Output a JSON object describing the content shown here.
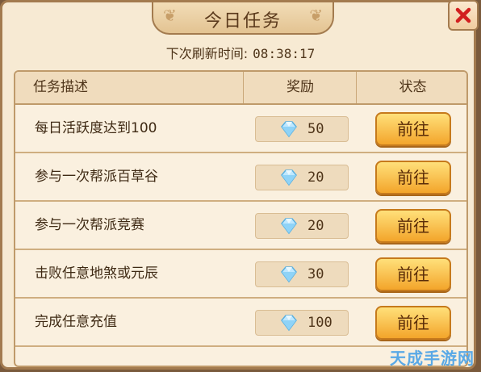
{
  "window": {
    "title": "今日任务"
  },
  "refresh": {
    "label": "下次刷新时间:",
    "time": "08:38:17"
  },
  "table": {
    "headers": {
      "desc": "任务描述",
      "reward": "奖励",
      "status": "状态"
    },
    "rows": [
      {
        "desc": "每日活跃度达到100",
        "reward": "50",
        "action": "前往"
      },
      {
        "desc": "参与一次帮派百草谷",
        "reward": "20",
        "action": "前往"
      },
      {
        "desc": "参与一次帮派竞赛",
        "reward": "20",
        "action": "前往"
      },
      {
        "desc": "击败任意地煞或元辰",
        "reward": "30",
        "action": "前往"
      },
      {
        "desc": "完成任意充值",
        "reward": "100",
        "action": "前往"
      }
    ]
  },
  "watermark": "天成手游网",
  "colors": {
    "panel": "#f7ead3",
    "border": "#a37b4f",
    "button": "#f3a52b",
    "close": "#d21f1f"
  },
  "icons": {
    "close": "close-icon",
    "reward": "gem-icon"
  }
}
